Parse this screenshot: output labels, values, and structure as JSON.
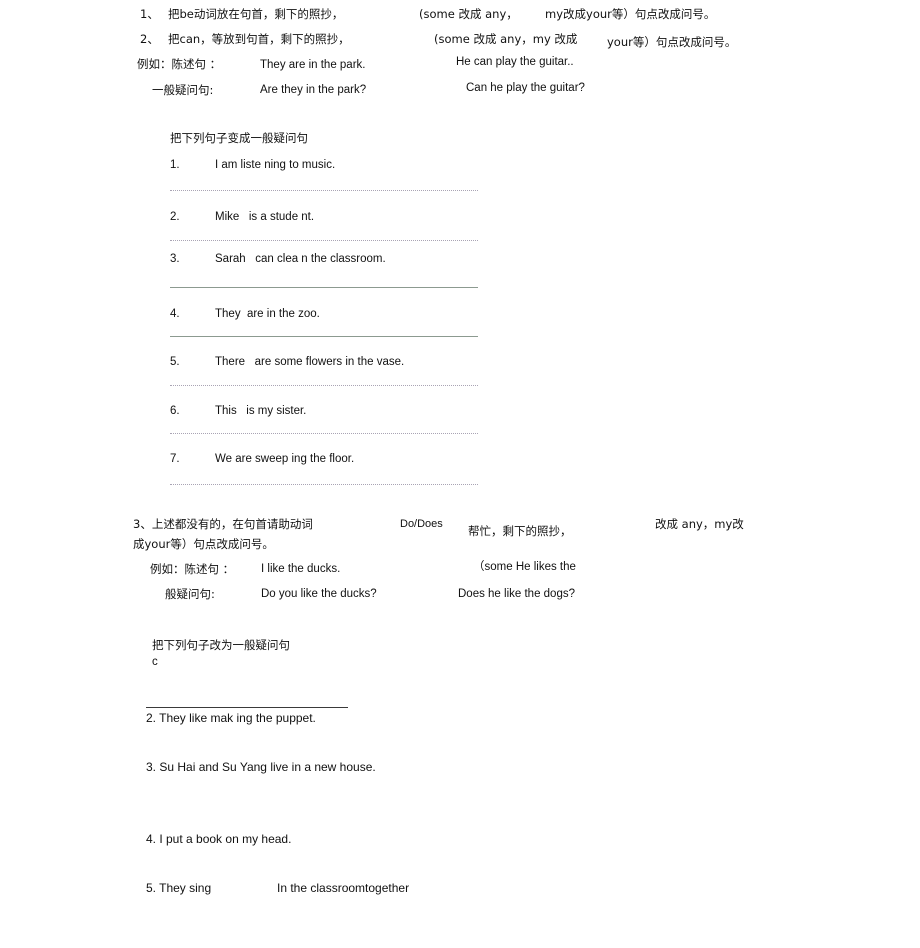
{
  "document": {
    "language_note": "Chinese/English grammar worksheet on forming general (yes/no) questions",
    "background_color": "#ffffff",
    "text_color": "#111111"
  },
  "rules_section": {
    "rule1": {
      "number": "1、",
      "text": "把be动词放在句首，剩下的照抄，",
      "note": "(some 改成 any，",
      "note2": "my改成your等）句点改成问号。"
    },
    "rule2": {
      "number": "2、",
      "text": "把can，等放到句首，剩下的照抄，",
      "note": "(some 改成 any，my 改成",
      "note2": "your等）句点改成问号。"
    },
    "example_label": "例如：陈述句 ：",
    "example_statement": "They are in the park.",
    "example_statement_right": "He can play the guitar..",
    "question_label": "一般疑问句:",
    "example_question": "Are they in the park?",
    "example_question_right": "Can he play the guitar?"
  },
  "exercise_one": {
    "heading": "把下列句子变成一般疑问句",
    "items": [
      {
        "num": "1.",
        "text": "I am liste ning to music."
      },
      {
        "num": "2.",
        "text": "Mike   is a stude nt."
      },
      {
        "num": "3.",
        "text": "Sarah   can clea n the classroom."
      },
      {
        "num": "4.",
        "text": "They  are in the zoo."
      },
      {
        "num": "5.",
        "text": "There   are some flowers in the vase."
      },
      {
        "num": "6.",
        "text": "This   is my sister."
      },
      {
        "num": "7.",
        "text": "We are sweep ing the floor."
      }
    ]
  },
  "rule_three": {
    "line1": "3、上述都没有的，在句首请助动词",
    "line1_aux": "Do/Does",
    "line1_help": "帮忙，剩下的照抄，",
    "line1_right": "改成 any，my改",
    "line2": "成your等）句点改成问号。",
    "example_label": "例如：陈述句 ：",
    "example_statement": "I like the ducks.",
    "example_statement_right": "（some He likes the",
    "question_label": "般疑问句:",
    "example_question": "Do you like the ducks?",
    "example_question_right": "Does he like the dogs?"
  },
  "exercise_two": {
    "heading": "把下列句子改为一般疑问句",
    "stray_char": "c",
    "items": [
      {
        "text": "2. They like mak ing the puppet."
      },
      {
        "text": "3. Su Hai and Su Yang live in a new house."
      },
      {
        "text": "4. I put a book on my head."
      },
      {
        "text": "5. They sing"
      }
    ],
    "item5_tail": "In the classroomtogether"
  }
}
